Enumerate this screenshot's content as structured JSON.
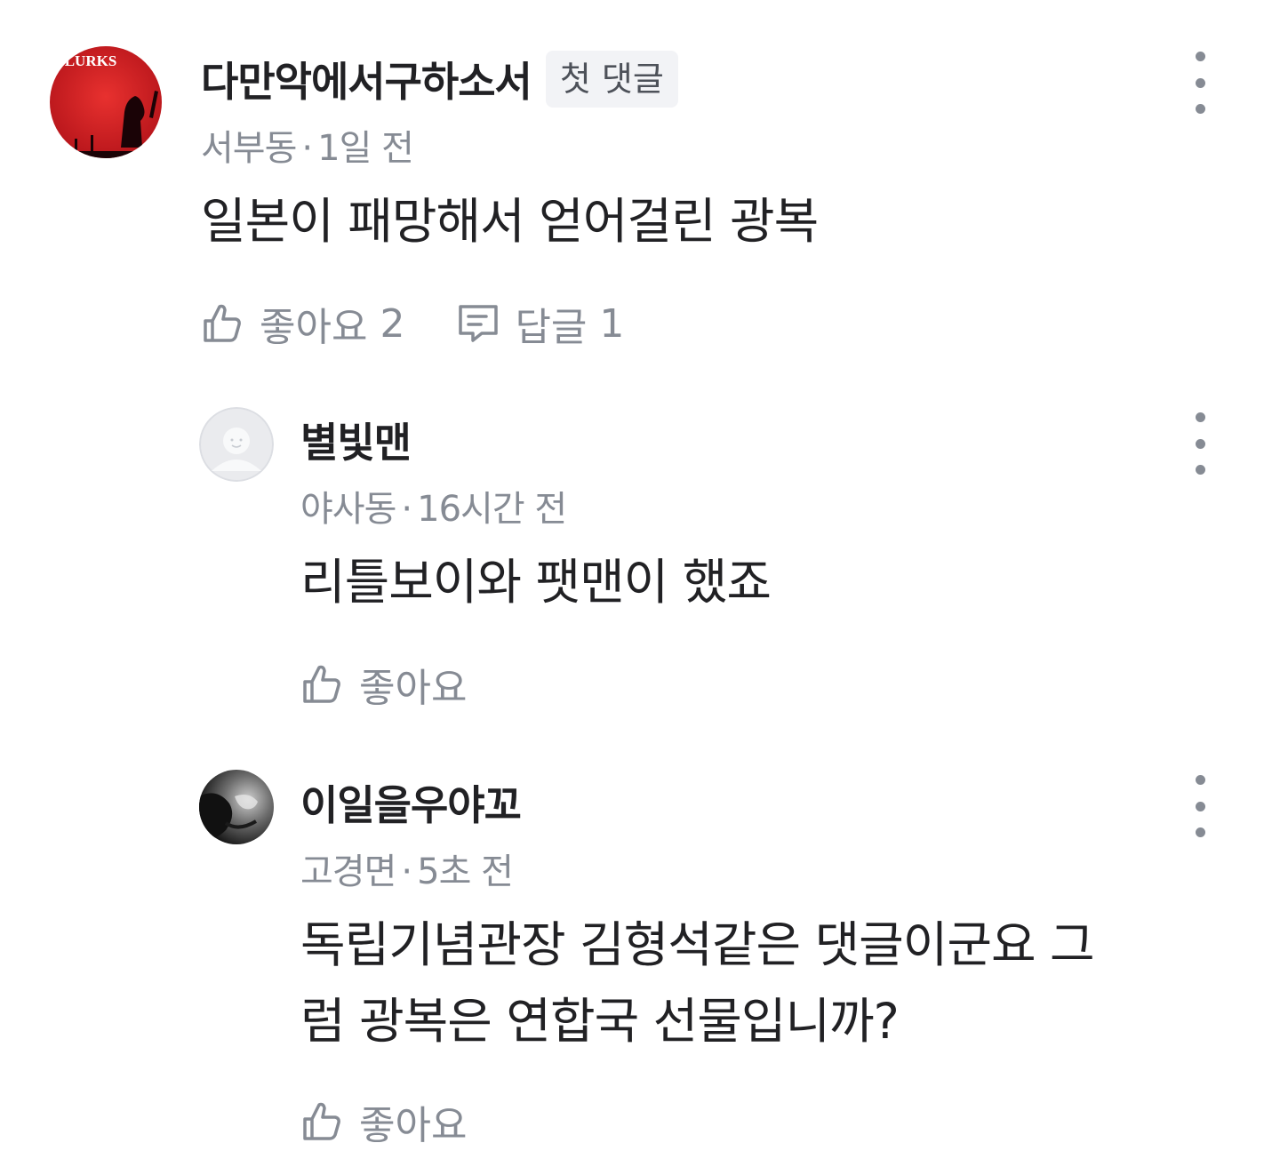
{
  "comments": [
    {
      "nickname": "다만악에서구하소서",
      "badge": "첫 댓글",
      "location": "서부동",
      "time": "1일 전",
      "text": "일본이 패망해서 얻어걸린 광복",
      "like_label": "좋아요",
      "like_count": "2",
      "reply_label": "답글",
      "reply_count": "1",
      "avatar_text": "LURKS"
    },
    {
      "nickname": "별빛맨",
      "location": "야사동",
      "time": "16시간 전",
      "text": "리틀보이와 팻맨이 했죠",
      "like_label": "좋아요"
    },
    {
      "nickname": "이일을우야꼬",
      "location": "고경면",
      "time": "5초 전",
      "text_line1": "독립기념관장 김형석같은 댓글이군요 그",
      "text_line2": "럼 광복은 연합국 선물입니까?",
      "like_label": "좋아요"
    }
  ],
  "separator": "·",
  "icons": {
    "like": "thumbs-up-icon",
    "reply": "speech-bubble-icon",
    "more": "more-vertical-icon"
  },
  "colors": {
    "text": "#212124",
    "secondary": "#868b94",
    "badge_bg": "#f2f3f6"
  }
}
